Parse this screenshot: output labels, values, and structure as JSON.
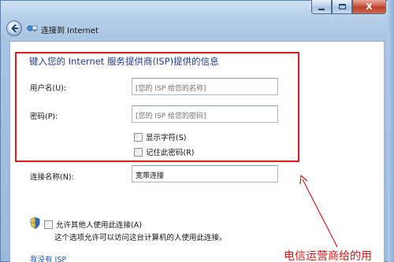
{
  "window": {
    "title": "连接到 Internet",
    "caption_buttons": {
      "minimize": "—",
      "maximize": "□",
      "close": "X"
    }
  },
  "navbar": {
    "back_icon": "back-arrow-icon",
    "network_icon": "network-icon"
  },
  "form": {
    "heading": "键入您的 Internet 服务提供商(ISP)提供的信息",
    "username": {
      "label": "用户名(U):",
      "placeholder": "[您的 ISP 给您的名称]"
    },
    "password": {
      "label": "密码(P):",
      "placeholder": "[您的 ISP 给您的密码]"
    },
    "show_chars": {
      "label": "显示字符(S)",
      "checked": false
    },
    "remember_pwd": {
      "label": "记住此密码(R)",
      "checked": false
    },
    "connection_name": {
      "label": "连接名称(N):",
      "value": "宽带连接"
    },
    "allow_others": {
      "label": "允许其他人使用此连接(A)",
      "note": "这个选项允许可以访问这台计算机的人使用此连接。",
      "checked": false,
      "shield_icon": "uac-shield-icon"
    },
    "no_isp_link": "我没有 ISP"
  },
  "annotation": {
    "text": "电信运营商给的用",
    "color": "#d21a1a"
  },
  "colors": {
    "accent_heading": "#1e3a8a",
    "red_box": "#e01a1a",
    "link": "#1a55b0"
  }
}
